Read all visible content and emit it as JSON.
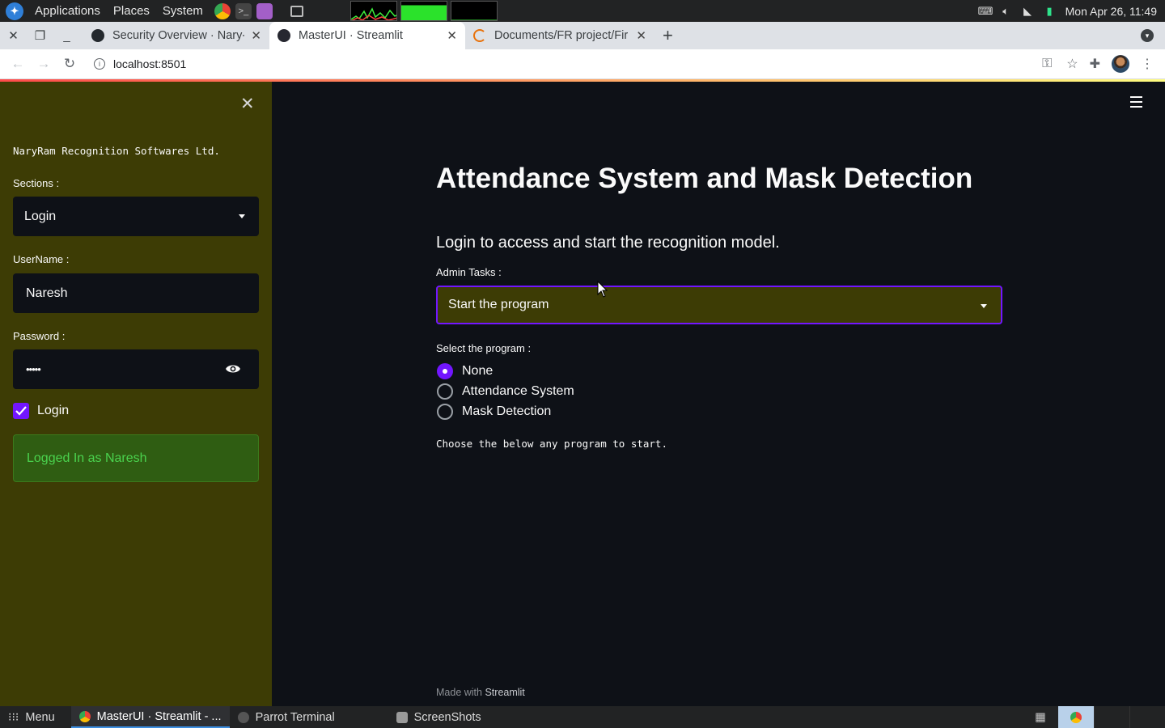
{
  "os_panel": {
    "menus": [
      "Applications",
      "Places",
      "System"
    ],
    "clock": "Mon Apr 26, 11:49"
  },
  "browser": {
    "tabs": [
      {
        "label": "Security Overview · Nary-V",
        "icon": "github-icon"
      },
      {
        "label": "MasterUI · Streamlit",
        "icon": "streamlit-icon",
        "active": true
      },
      {
        "label": "Documents/FR project/Fir",
        "icon": "loading-icon"
      }
    ],
    "url": "localhost:8501"
  },
  "sidebar": {
    "company": "NaryRam Recognition Softwares Ltd.",
    "sections_label": "Sections :",
    "sections_value": "Login",
    "username_label": "UserName :",
    "username_value": "Naresh",
    "password_label": "Password :",
    "password_value": "•••••",
    "login_checkbox_label": "Login",
    "login_checked": true,
    "success_message": "Logged In as Naresh"
  },
  "main": {
    "title": "Attendance System and Mask Detection",
    "subheader": "Login to access and start the recognition model.",
    "admin_tasks_label": "Admin Tasks :",
    "admin_tasks_value": "Start the program",
    "program_label": "Select the program :",
    "program_options": [
      "None",
      "Attendance System",
      "Mask Detection"
    ],
    "program_selected": "None",
    "hint": "Choose the below any program to start.",
    "footer_prefix": "Made with",
    "footer_brand": "Streamlit"
  },
  "taskbar": {
    "menu_label": "Menu",
    "tasks": [
      "MasterUI · Streamlit - ...",
      "Parrot Terminal",
      "ScreenShots"
    ]
  },
  "colors": {
    "accent": "#7216ff",
    "sidebar_bg": "#3d3c05",
    "main_bg": "#0e1117",
    "success_text": "#4ad24e"
  }
}
